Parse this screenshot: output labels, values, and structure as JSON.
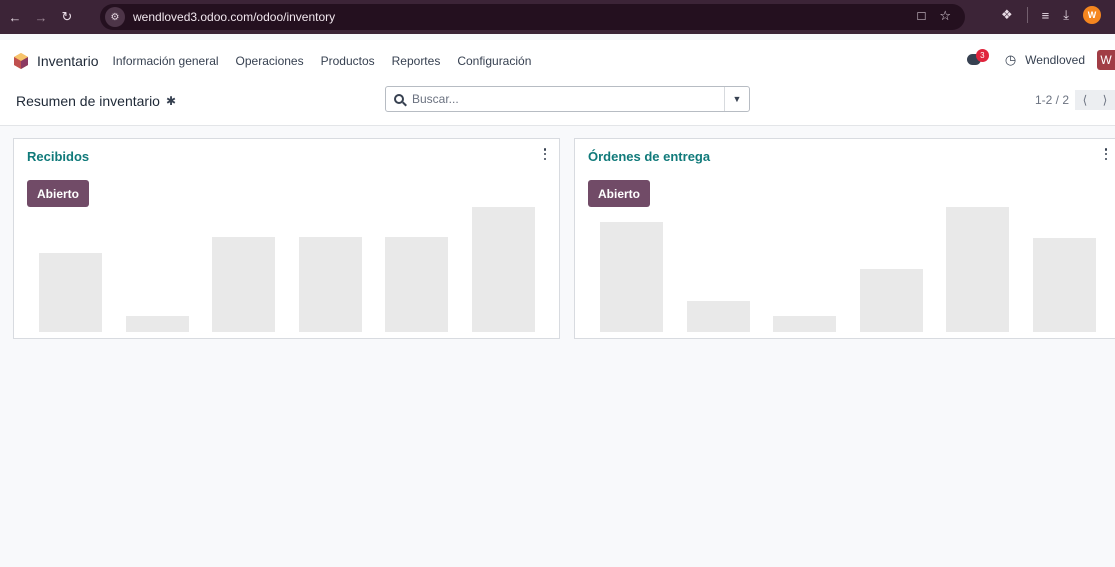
{
  "browser": {
    "url": "wendloved3.odoo.com/odoo/inventory",
    "profile_initial": "W"
  },
  "navbar": {
    "app_name": "Inventario",
    "menu": [
      "Información general",
      "Operaciones",
      "Productos",
      "Reportes",
      "Configuración"
    ],
    "chat_badge": "3",
    "username": "Wendloved",
    "avatar_initial": "W"
  },
  "control_panel": {
    "breadcrumb": "Resumen de inventario",
    "search_placeholder": "Buscar...",
    "pager": "1-2 / 2"
  },
  "cards": [
    {
      "title": "Recibidos",
      "button": "Abierto",
      "bar_levels": [
        0.63,
        0.13,
        0.76,
        0.76,
        0.76,
        1.0
      ]
    },
    {
      "title": "Órdenes de entrega",
      "button": "Abierto",
      "bar_levels": [
        0.88,
        0.25,
        0.13,
        0.5,
        1.0,
        0.75
      ]
    }
  ],
  "colors": {
    "chrome": "#3c2437",
    "brand": "#714b67",
    "card_title": "#107a7a",
    "placeholder_bar": "#e9e9e9"
  }
}
